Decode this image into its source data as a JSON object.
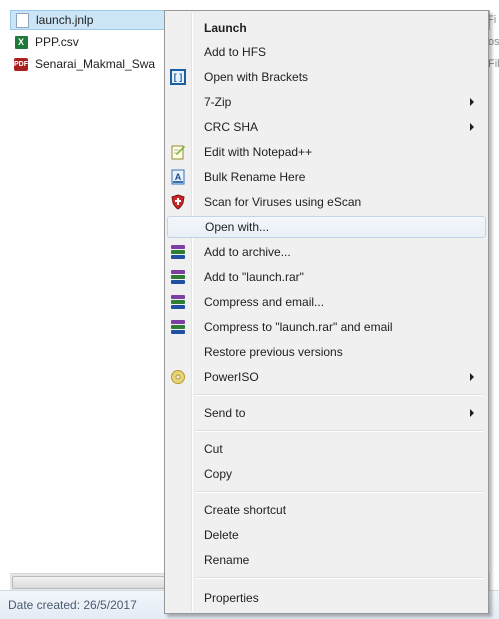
{
  "explorer": {
    "files": [
      {
        "name": "launch.jnlp",
        "icon": "jnlp-file-icon",
        "selected": true
      },
      {
        "name": "PPP.csv",
        "icon": "excel-file-icon",
        "selected": false
      },
      {
        "name": "Senarai_Makmal_Swa",
        "icon": "pdf-file-icon",
        "selected": false
      }
    ],
    "behind_fragments": [
      "Fi",
      "os",
      "Fil"
    ],
    "status_text": "Date created: 26/5/2017"
  },
  "context_menu": {
    "hovered_item": "Open with...",
    "items": [
      {
        "label": "Launch",
        "bold": true,
        "icon": null,
        "submenu": false
      },
      {
        "label": "Add to HFS",
        "icon": null,
        "submenu": false
      },
      {
        "label": "Open with Brackets",
        "icon": "brackets-icon",
        "submenu": false
      },
      {
        "label": "7-Zip",
        "icon": null,
        "submenu": true
      },
      {
        "label": "CRC SHA",
        "icon": null,
        "submenu": true
      },
      {
        "label": "Edit with Notepad++",
        "icon": "notepad-plus-plus-icon",
        "submenu": false
      },
      {
        "label": "Bulk Rename Here",
        "icon": "bulk-rename-icon",
        "submenu": false
      },
      {
        "label": "Scan for Viruses using eScan",
        "icon": "escan-shield-icon",
        "submenu": false
      },
      {
        "label": "Open with...",
        "icon": null,
        "submenu": false
      },
      {
        "label": "Add to archive...",
        "icon": "winrar-icon",
        "submenu": false
      },
      {
        "label": "Add to \"launch.rar\"",
        "icon": "winrar-icon",
        "submenu": false
      },
      {
        "label": "Compress and email...",
        "icon": "winrar-icon",
        "submenu": false
      },
      {
        "label": "Compress to \"launch.rar\" and email",
        "icon": "winrar-icon",
        "submenu": false
      },
      {
        "label": "Restore previous versions",
        "icon": null,
        "submenu": false
      },
      {
        "label": "PowerISO",
        "icon": "poweriso-disc-icon",
        "submenu": true
      },
      {
        "label": "Send to",
        "icon": null,
        "submenu": true
      },
      {
        "label": "Cut",
        "icon": null,
        "submenu": false
      },
      {
        "label": "Copy",
        "icon": null,
        "submenu": false
      },
      {
        "label": "Create shortcut",
        "icon": null,
        "submenu": false
      },
      {
        "label": "Delete",
        "icon": null,
        "submenu": false
      },
      {
        "label": "Rename",
        "icon": null,
        "submenu": false
      },
      {
        "label": "Properties",
        "icon": null,
        "submenu": false
      }
    ]
  },
  "colors": {
    "selection": "#cde6f7",
    "menu_background": "#f0f0f0",
    "winrar": "#6b2a8c",
    "escan": "#c62828"
  }
}
